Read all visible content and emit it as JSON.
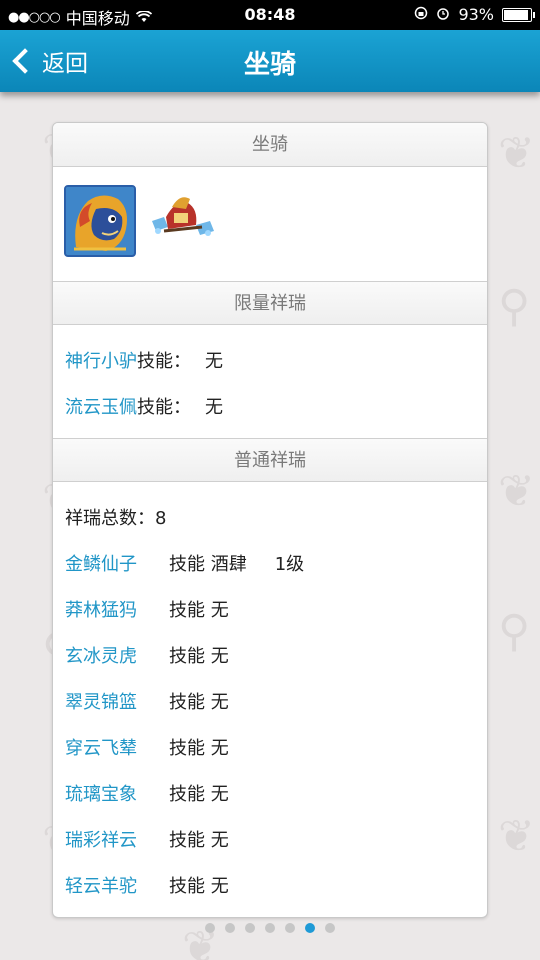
{
  "status_bar": {
    "carrier": "中国移动",
    "time": "08:48",
    "battery_percent": "93%",
    "battery_level": 0.93
  },
  "nav": {
    "back_label": "返回",
    "title": "坐骑"
  },
  "card": {
    "mount_section_title": "坐骑",
    "limited_section_title": "限量祥瑞",
    "limited_items": [
      {
        "name": "神行小驴",
        "skill_label": "技能：",
        "skill_value": "无"
      },
      {
        "name": "流云玉佩",
        "skill_label": "技能：",
        "skill_value": "无"
      }
    ],
    "normal_section_title": "普通祥瑞",
    "total_label": "祥瑞总数：",
    "total_value": "8",
    "normal_items": [
      {
        "name": "金鳞仙子",
        "skill_label": "技能",
        "skill_value": "酒肆",
        "level": "1级"
      },
      {
        "name": "莽林猛犸",
        "skill_label": "技能",
        "skill_value": "无"
      },
      {
        "name": "玄冰灵虎",
        "skill_label": "技能",
        "skill_value": "无"
      },
      {
        "name": "翠灵锦篮",
        "skill_label": "技能",
        "skill_value": "无"
      },
      {
        "name": "穿云飞辇",
        "skill_label": "技能",
        "skill_value": "无"
      },
      {
        "name": "琉璃宝象",
        "skill_label": "技能",
        "skill_value": "无"
      },
      {
        "name": "瑞彩祥云",
        "skill_label": "技能",
        "skill_value": "无"
      },
      {
        "name": "轻云羊驼",
        "skill_label": "技能",
        "skill_value": "无"
      }
    ]
  },
  "pager": {
    "page_count": 7,
    "active_index": 5
  },
  "colors": {
    "nav_blue": "#0b86b8",
    "link_blue": "#2196c7",
    "active_dot": "#1e9ad6"
  }
}
